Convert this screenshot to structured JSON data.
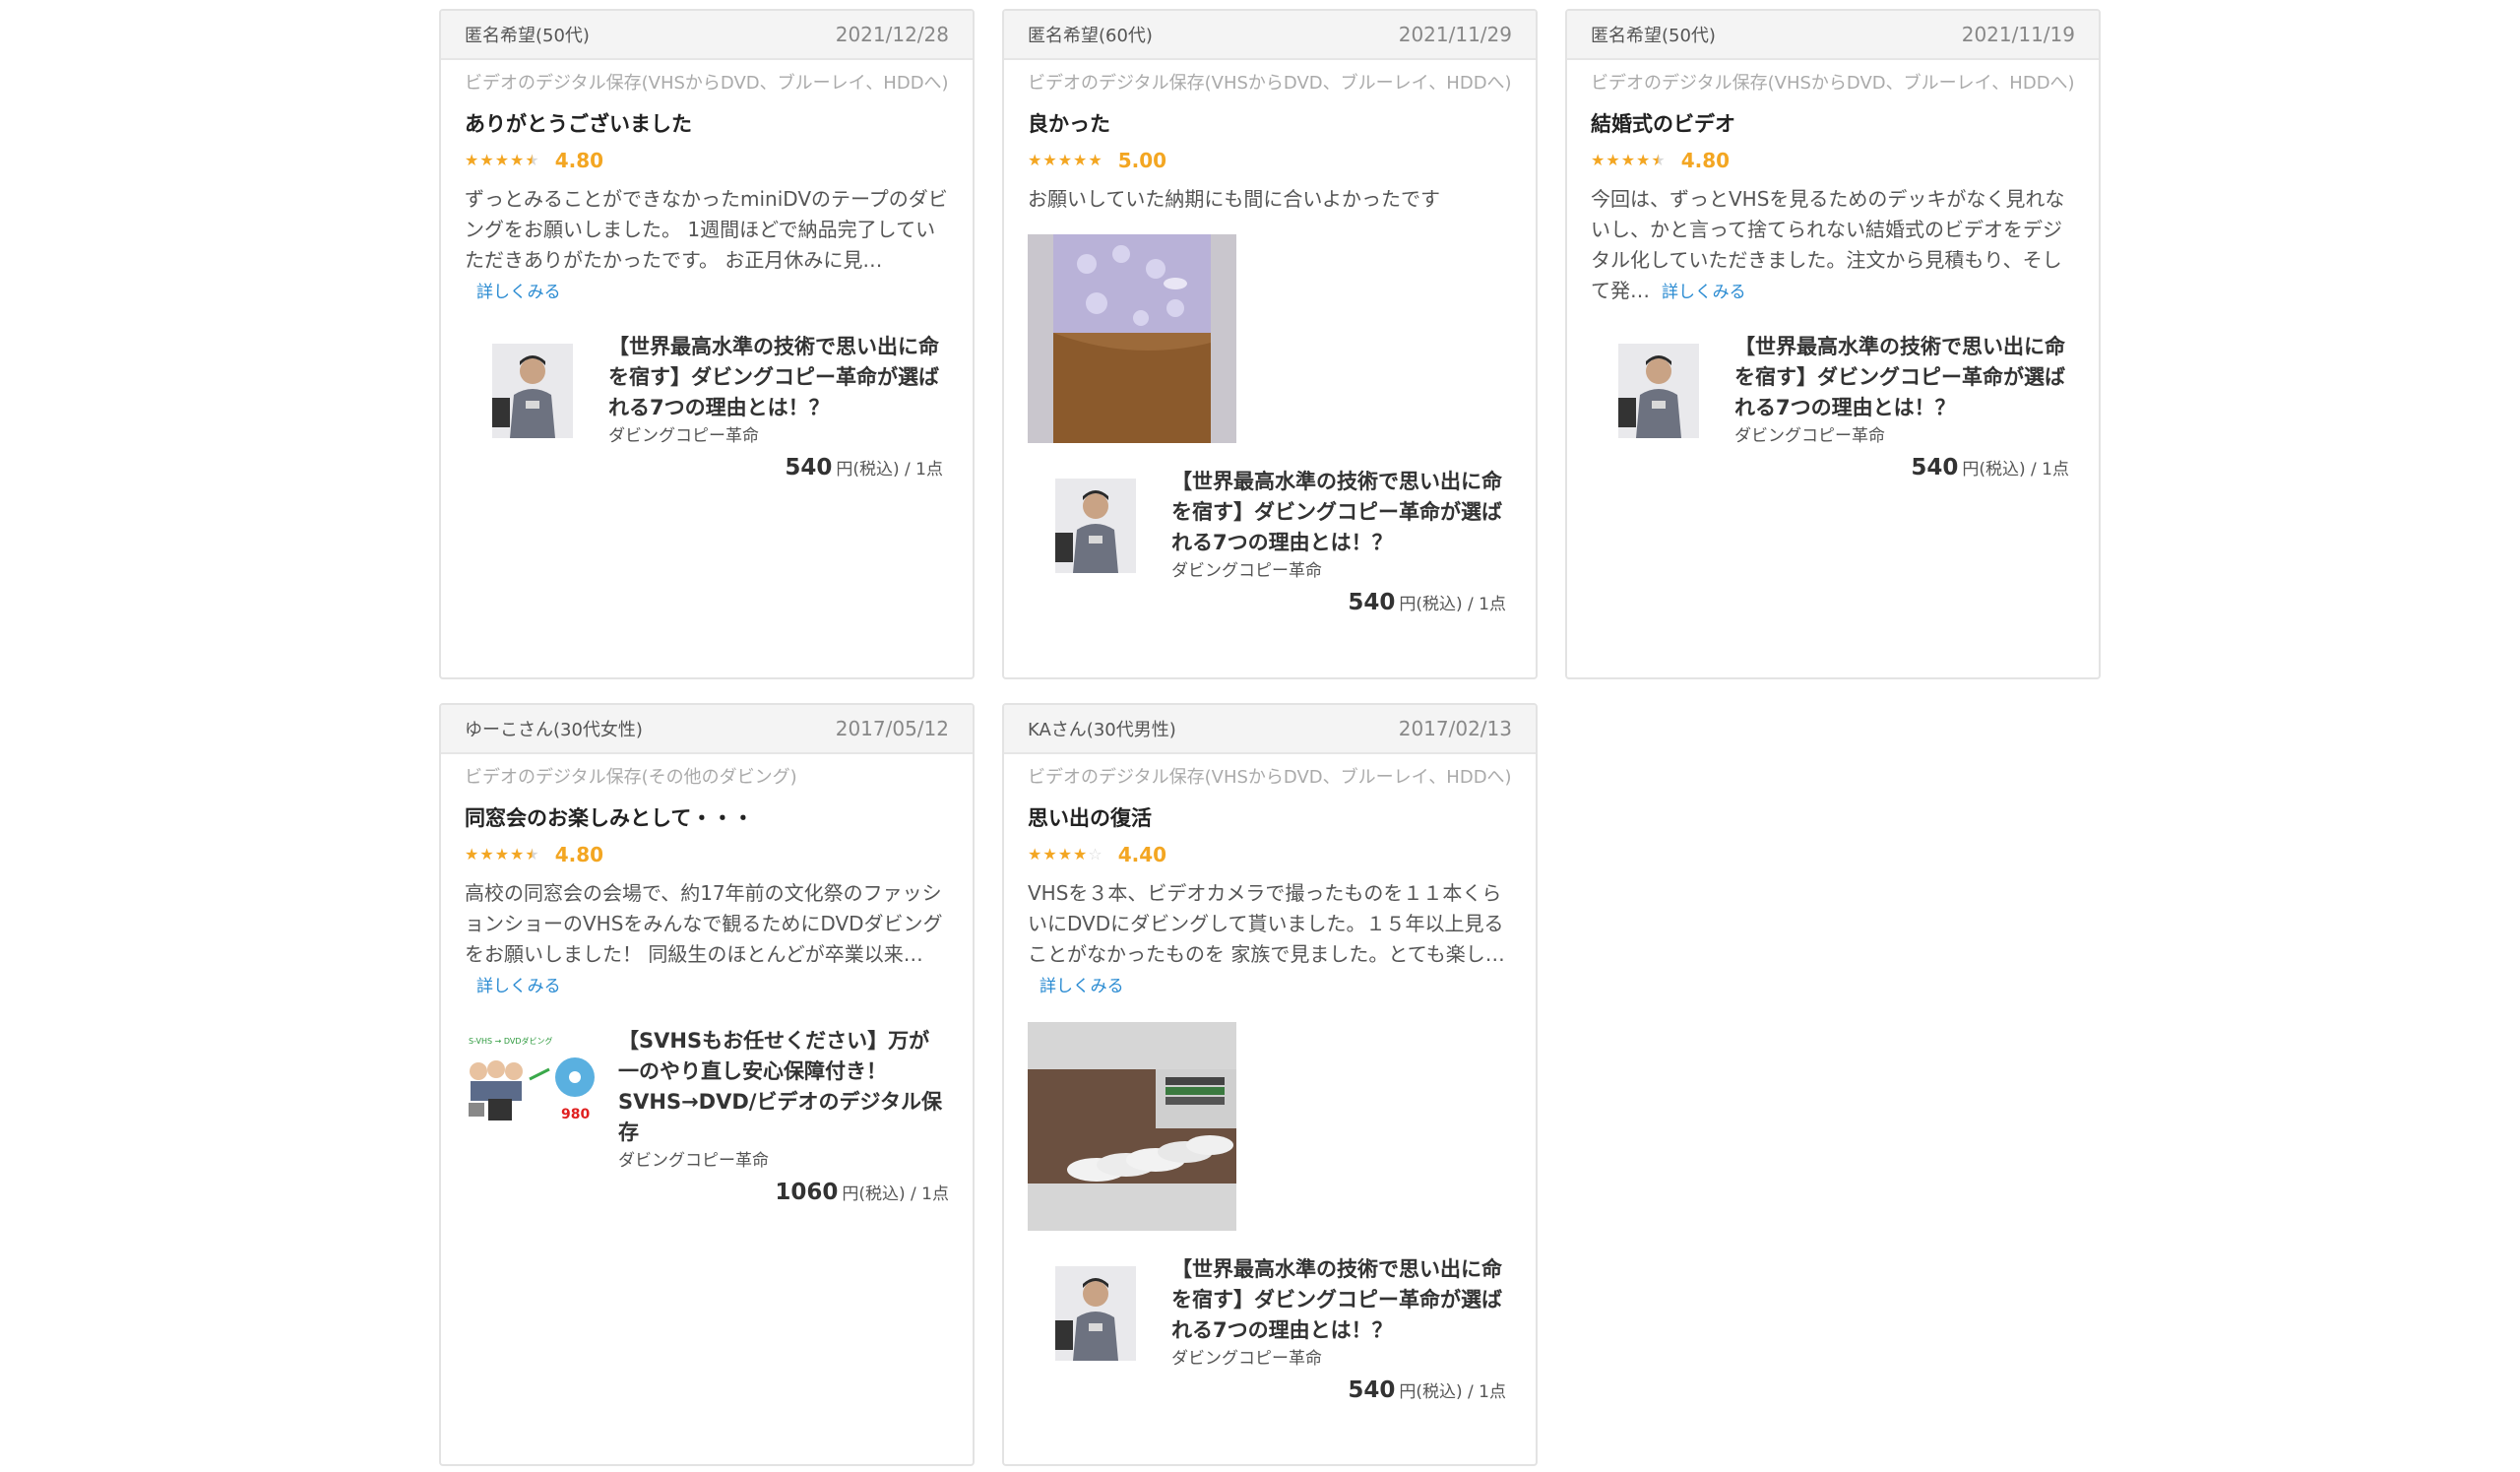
{
  "reviews": [
    {
      "user": "匿名希望(50代)",
      "date": "2021/12/28",
      "category": "ビデオのデジタル保存(VHSからDVD、ブルーレイ、HDDへ)",
      "title": "ありがとうございました",
      "rating": 4.8,
      "score": "4.80",
      "text": "ずっとみることができなかったminiDVのテープのダビングをお願いしました。 1週間ほどで納品完了していただきありがたかったです。 お正月休みに見…",
      "more": "詳しくみる",
      "product": {
        "title": "【世界最高水準の技術で思い出に命を宿す】ダビングコピー革命が選ばれる7つの理由とは！？",
        "shop": "ダビングコピー革命",
        "price": "540",
        "price_unit": "円(税込) / 1点"
      }
    },
    {
      "user": "匿名希望(60代)",
      "date": "2021/11/29",
      "category": "ビデオのデジタル保存(VHSからDVD、ブルーレイ、HDDへ)",
      "title": "良かった",
      "rating": 5.0,
      "score": "5.00",
      "text": "お願いしていた納期にも間に合いよかったです",
      "product": {
        "title": "【世界最高水準の技術で思い出に命を宿す】ダビングコピー革命が選ばれる7つの理由とは！？",
        "shop": "ダビングコピー革命",
        "price": "540",
        "price_unit": "円(税込) / 1点"
      }
    },
    {
      "user": "匿名希望(50代)",
      "date": "2021/11/19",
      "category": "ビデオのデジタル保存(VHSからDVD、ブルーレイ、HDDへ)",
      "title": "結婚式のビデオ",
      "rating": 4.8,
      "score": "4.80",
      "text": "今回は、ずっとVHSを見るためのデッキがなく見れないし、かと言って捨てられない結婚式のビデオをデジタル化していただきました。注文から見積もり、そして発…",
      "more": "詳しくみる",
      "product": {
        "title": "【世界最高水準の技術で思い出に命を宿す】ダビングコピー革命が選ばれる7つの理由とは！？",
        "shop": "ダビングコピー革命",
        "price": "540",
        "price_unit": "円(税込) / 1点"
      }
    },
    {
      "user": "ゆーこさん(30代女性)",
      "date": "2017/05/12",
      "category": "ビデオのデジタル保存(その他のダビング)",
      "title": "同窓会のお楽しみとして・・・",
      "rating": 4.8,
      "score": "4.80",
      "text": "高校の同窓会の会場で、約17年前の文化祭のファッションショーのVHSをみんなで観るためにDVDダビングをお願いしました！ 同級生のほとんどが卒業以来…",
      "more": "詳しくみる",
      "product": {
        "title": "【SVHSもお任せください】万が一のやり直し安心保障付き！SVHS→DVD/ビデオのデジタル保存",
        "shop": "ダビングコピー革命",
        "price": "1060",
        "price_unit": "円(税込) / 1点",
        "thumb_label": "S-VHS → DVDダビング",
        "thumb_price": "980"
      }
    },
    {
      "user": "KAさん(30代男性)",
      "date": "2017/02/13",
      "category": "ビデオのデジタル保存(VHSからDVD、ブルーレイ、HDDへ)",
      "title": "思い出の復活",
      "rating": 4.4,
      "score": "4.40",
      "text": "VHSを３本、ビデオカメラで撮ったものを１１本くらいにDVDにダビングして貰いました。１５年以上見ることがなかったものを 家族で見ました。とても楽し…",
      "more": "詳しくみる",
      "product": {
        "title": "【世界最高水準の技術で思い出に命を宿す】ダビングコピー革命が選ばれる7つの理由とは！？",
        "shop": "ダビングコピー革命",
        "price": "540",
        "price_unit": "円(税込) / 1点"
      }
    }
  ]
}
